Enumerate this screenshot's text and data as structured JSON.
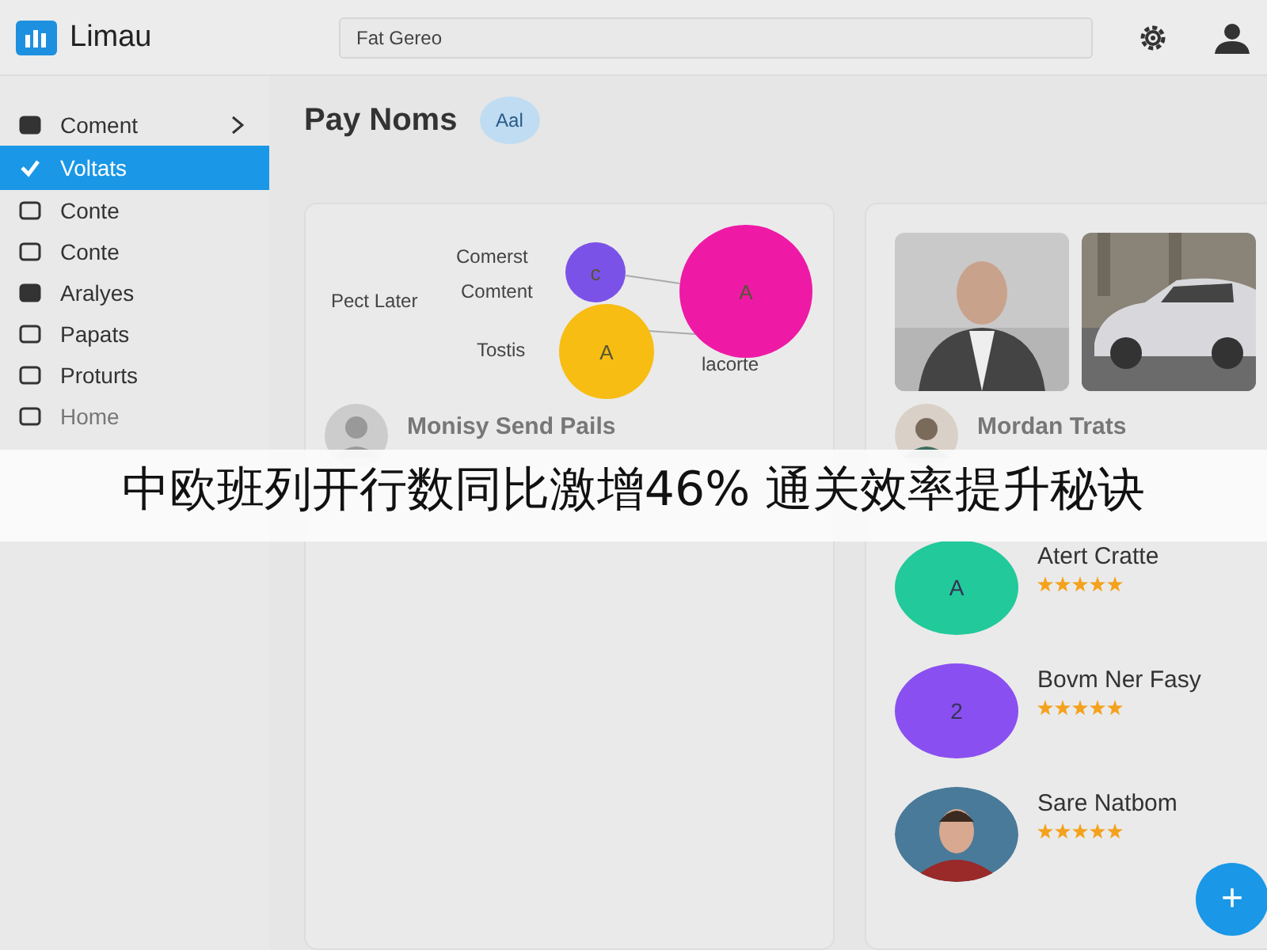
{
  "app": {
    "name": "Limau"
  },
  "search": {
    "placeholder": "Fat Gereo"
  },
  "sidebar": {
    "items": [
      {
        "label": "Coment",
        "selected": false,
        "expandable": true
      },
      {
        "label": "Voltats",
        "selected": true,
        "expandable": false
      },
      {
        "label": "Conte",
        "selected": false,
        "expandable": false
      },
      {
        "label": "Conte",
        "selected": false,
        "expandable": false
      },
      {
        "label": "Aralyes",
        "selected": false,
        "expandable": false
      },
      {
        "label": "Papats",
        "selected": false,
        "expandable": false
      },
      {
        "label": "Proturts",
        "selected": false,
        "expandable": false
      },
      {
        "label": "Home",
        "selected": false,
        "expandable": false
      }
    ]
  },
  "page": {
    "title": "Pay Noms",
    "badge": "Aal"
  },
  "diagram": {
    "labels": [
      "Comerst",
      "Comtent",
      "Pect Later",
      "Tostis",
      "lacorte"
    ],
    "nodes": [
      {
        "letter": "c",
        "color": "#7b52e8"
      },
      {
        "letter": "A",
        "color": "#ee1aa6"
      },
      {
        "letter": "A",
        "color": "#f7bd12"
      }
    ]
  },
  "left_profile": {
    "name": "Monisy Send Pails"
  },
  "right_card": {
    "profile": {
      "name": "Mordan Trats"
    },
    "contacts": [
      {
        "kind": "letter",
        "letter": "A",
        "color": "#22c99a",
        "name": "Atert Cratte",
        "stars": 5
      },
      {
        "kind": "letter",
        "letter": "2",
        "color": "#8a4ff0",
        "name": "Bovm Ner Fasy",
        "stars": 5
      },
      {
        "kind": "picture",
        "name": "Sare Natbom",
        "stars": 5
      }
    ]
  },
  "fab": {
    "symbol": "+"
  },
  "caption_banner": {
    "text": "中欧班列开行数同比激增46% 通关效率提升秘诀"
  }
}
